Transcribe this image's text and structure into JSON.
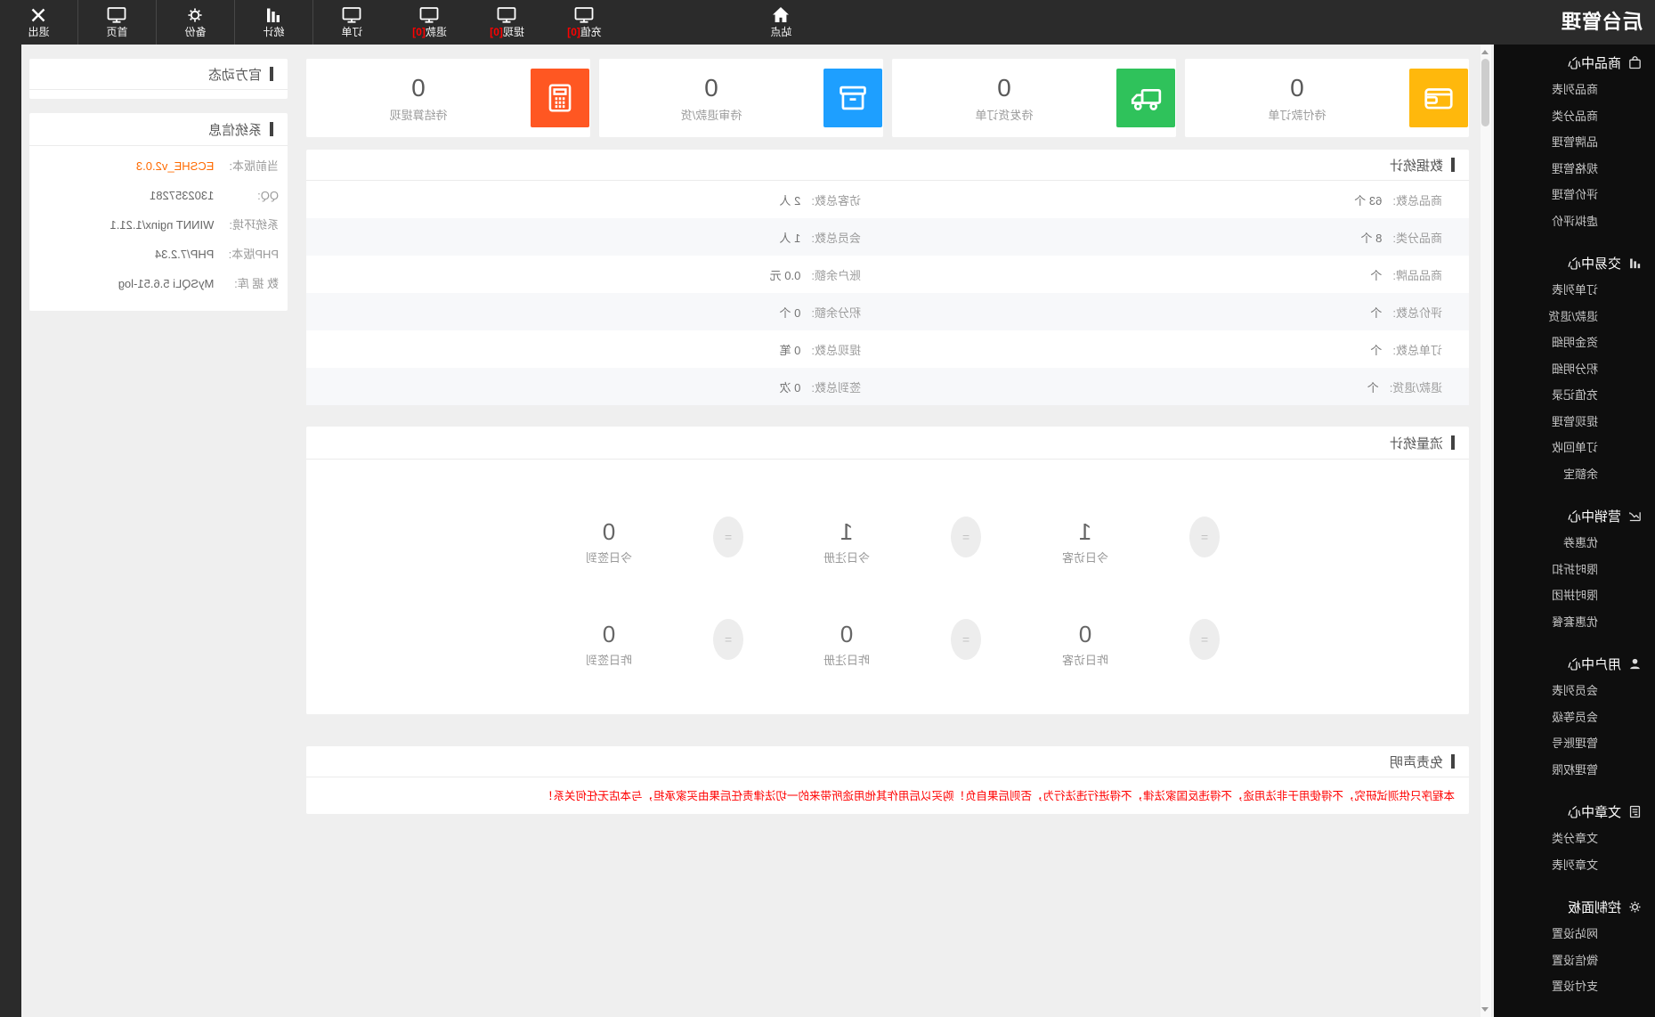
{
  "page": {
    "title": "后台管理"
  },
  "navbar": {
    "logo": "后台管理",
    "items": [
      {
        "label": "站点",
        "icon": "home"
      },
      {
        "label": "充值",
        "badge": "[0]",
        "icon": "monitor"
      },
      {
        "label": "提现",
        "badge": "[0]",
        "icon": "monitor"
      },
      {
        "label": "退款",
        "badge": "[0]",
        "icon": "monitor"
      },
      {
        "label": "订单",
        "icon": "monitor"
      },
      {
        "label": "统计",
        "icon": "bar-chart"
      },
      {
        "label": "备份",
        "icon": "gear"
      },
      {
        "label": "首页",
        "icon": "monitor"
      },
      {
        "label": "退出",
        "icon": "close"
      }
    ]
  },
  "sidebar": {
    "sections": [
      {
        "title": "商品中心",
        "icon": "shopping-bag",
        "items": [
          "商品列表",
          "商品分类",
          "品牌管理",
          "规格管理",
          "评价管理",
          "虚拟评价"
        ]
      },
      {
        "title": "交易中心",
        "icon": "bar-chart",
        "items": [
          "订单列表",
          "退款/退货",
          "资金明细",
          "积分明细",
          "充值记录",
          "提现管理",
          "订单回收",
          "余额宝"
        ]
      },
      {
        "title": "营销中心",
        "icon": "trend-chart",
        "items": [
          "优惠券",
          "限时折扣",
          "限时拼团",
          "优惠套餐"
        ]
      },
      {
        "title": "用户中心",
        "icon": "user",
        "items": [
          "会员列表",
          "会员等级",
          "管理账号",
          "管理权限"
        ]
      },
      {
        "title": "文章中心",
        "icon": "document",
        "items": [
          "文章分类",
          "文章列表"
        ]
      },
      {
        "title": "控制面板",
        "icon": "gear",
        "items": [
          "网站设置",
          "微信设置",
          "支付设置"
        ]
      }
    ]
  },
  "cards": [
    {
      "value": "0",
      "label": "待付款订单",
      "icon": "wallet",
      "color": "#ffb80c"
    },
    {
      "value": "0",
      "label": "待发货订单",
      "icon": "truck",
      "color": "#2fc25b"
    },
    {
      "value": "0",
      "label": "待审退款/货",
      "icon": "box",
      "color": "#1e9fff"
    },
    {
      "value": "0",
      "label": "待结算提现",
      "icon": "calculator",
      "color": "#ff5722"
    }
  ],
  "data_stats": {
    "title": "数据统计",
    "rows": [
      {
        "left_label": "商品总数:",
        "left_value": "63 个",
        "right_label": "访客总数:",
        "right_value": "2 人"
      },
      {
        "left_label": "商品分类:",
        "left_value": "8 个",
        "right_label": "会员总数:",
        "right_value": "1 人"
      },
      {
        "left_label": "商品品牌:",
        "left_value": "个",
        "right_label": "账户余额:",
        "right_value": "0.0 元"
      },
      {
        "left_label": "评价总数:",
        "left_value": "个",
        "right_label": "积分余额:",
        "right_value": "0 个"
      },
      {
        "left_label": "订单总数:",
        "left_value": "个",
        "right_label": "提现总数:",
        "right_value": "0 笔"
      },
      {
        "left_label": "退款/退货:",
        "left_value": "个",
        "right_label": "签到总数:",
        "right_value": "0 次"
      }
    ]
  },
  "traffic_stats": {
    "title": "流量统计",
    "equals_glyph": "=",
    "rows": [
      {
        "metrics": [
          {
            "value": "1",
            "label": "今日访客"
          },
          {
            "value": "1",
            "label": "今日注册"
          },
          {
            "value": "0",
            "label": "今日签到"
          }
        ]
      },
      {
        "metrics": [
          {
            "value": "0",
            "label": "昨日访客"
          },
          {
            "value": "0",
            "label": "昨日注册"
          },
          {
            "value": "0",
            "label": "昨日签到"
          }
        ]
      }
    ]
  },
  "disclaimer": {
    "title": "免责声明",
    "text": "本程序只供测试研究，不得使用于非法用途，不得违反国家法律，不得进行违法行为，否则后果自负！购买以后用作其他用途所带来的一切法律责任后果由买家承担，与本店无任何关系！"
  },
  "official_news": {
    "title": "官方动态"
  },
  "system_info": {
    "title": "系统信息",
    "rows": [
      {
        "label": "当前版本:",
        "value": "ECSHE_v2.0.3"
      },
      {
        "label": "QQ:",
        "value": "1302357281"
      },
      {
        "label": "系统环境:",
        "value": "WINNT nginx/1.21.1"
      },
      {
        "label": "PHP版本:",
        "value": "PHP/7.2.34"
      },
      {
        "label": "数 据 库:",
        "value": "MySQLi 5.6.51-log"
      }
    ]
  }
}
